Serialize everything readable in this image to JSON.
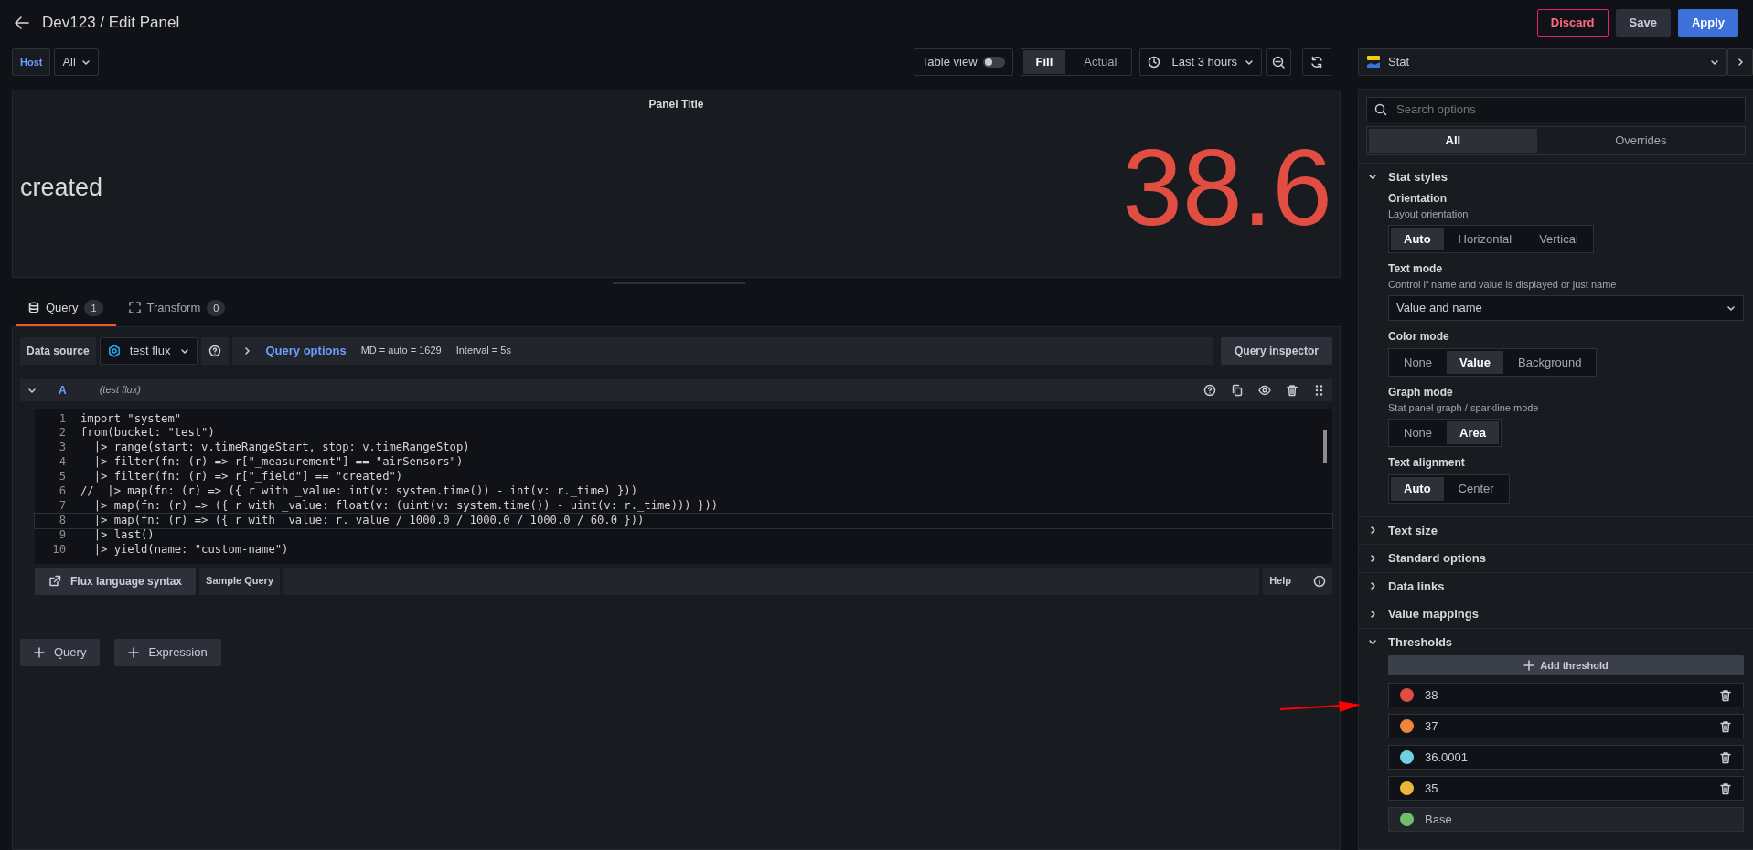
{
  "header": {
    "title": "Dev123 / Edit Panel",
    "buttons": [
      {
        "label": "Discard",
        "kind": "danger"
      },
      {
        "label": "Save",
        "kind": "secondary"
      },
      {
        "label": "Apply",
        "kind": "primary"
      }
    ]
  },
  "variables": [
    {
      "label": "Host",
      "value": "All"
    }
  ],
  "toolbar": {
    "table_view": {
      "label": "Table view",
      "on": false
    },
    "size_modes": [
      {
        "label": "Fill",
        "selected": true
      },
      {
        "label": "Actual",
        "selected": false
      }
    ],
    "time_range": "Last 3 hours"
  },
  "panel": {
    "title": "Panel Title",
    "name": "created",
    "value": "38.6"
  },
  "query_tabs": [
    {
      "label": "Query",
      "count": "1",
      "selected": true
    },
    {
      "label": "Transform",
      "count": "0",
      "selected": false
    }
  ],
  "query_bar": {
    "data_source_label": "Data source",
    "data_source": "test flux",
    "options_label": "Query options",
    "md": "MD = auto = 1629",
    "interval": "Interval = 5s",
    "inspector": "Query inspector"
  },
  "query": {
    "ref": "A",
    "source": "(test flux)",
    "expanded": true,
    "lines": [
      {
        "number": "1",
        "text": "import \"system\"",
        "current": false
      },
      {
        "number": "2",
        "text": "from(bucket: \"test\")",
        "current": false
      },
      {
        "number": "3",
        "text": "  |> range(start: v.timeRangeStart, stop: v.timeRangeStop)",
        "current": false
      },
      {
        "number": "4",
        "text": "  |> filter(fn: (r) => r[\"_measurement\"] == \"airSensors\")",
        "current": false
      },
      {
        "number": "5",
        "text": "  |> filter(fn: (r) => r[\"_field\"] == \"created\")",
        "current": false
      },
      {
        "number": "6",
        "text": "//  |> map(fn: (r) => ({ r with _value: int(v: system.time()) - int(v: r._time) }))",
        "current": false
      },
      {
        "number": "7",
        "text": "  |> map(fn: (r) => ({ r with _value: float(v: (uint(v: system.time()) - uint(v: r._time))) }))",
        "current": false
      },
      {
        "number": "8",
        "text": "  |> map(fn: (r) => ({ r with _value: r._value / 1000.0 / 1000.0 / 1000.0 / 60.0 }))",
        "current": true
      },
      {
        "number": "9",
        "text": "  |> last()",
        "current": false
      },
      {
        "number": "10",
        "text": "  |> yield(name: \"custom-name\")",
        "current": false
      }
    ]
  },
  "editor_footer": {
    "syntax": "Flux language syntax",
    "sample": "Sample Query",
    "help": "Help"
  },
  "add_buttons": [
    "Query",
    "Expression"
  ],
  "visualization": "Stat",
  "options": {
    "search_placeholder": "Search options",
    "tabs": [
      {
        "label": "All",
        "selected": true
      },
      {
        "label": "Overrides",
        "selected": false
      }
    ],
    "sections": [
      {
        "title": "Stat styles",
        "expanded": true,
        "fields": [
          {
            "kind": "radio",
            "label": "Orientation",
            "description": "Layout orientation",
            "options": [
              {
                "label": "Auto",
                "selected": true
              },
              {
                "label": "Horizontal",
                "selected": false
              },
              {
                "label": "Vertical",
                "selected": false
              }
            ]
          },
          {
            "kind": "select",
            "label": "Text mode",
            "description": "Control if name and value is displayed or just name",
            "value": "Value and name"
          },
          {
            "kind": "radio",
            "label": "Color mode",
            "options": [
              {
                "label": "None",
                "selected": false
              },
              {
                "label": "Value",
                "selected": true
              },
              {
                "label": "Background",
                "selected": false
              }
            ]
          },
          {
            "kind": "radio",
            "label": "Graph mode",
            "description": "Stat panel graph / sparkline mode",
            "options": [
              {
                "label": "None",
                "selected": false
              },
              {
                "label": "Area",
                "selected": true
              }
            ]
          },
          {
            "kind": "radio",
            "label": "Text alignment",
            "options": [
              {
                "label": "Auto",
                "selected": true
              },
              {
                "label": "Center",
                "selected": false
              }
            ]
          }
        ]
      },
      {
        "title": "Text size",
        "expanded": false
      },
      {
        "title": "Standard options",
        "expanded": false
      },
      {
        "title": "Data links",
        "expanded": false
      },
      {
        "title": "Value mappings",
        "expanded": false
      },
      {
        "title": "Thresholds",
        "expanded": true,
        "add_label": "Add threshold",
        "thresholds": [
          {
            "kind": "step",
            "value": "38",
            "color": "#e24d42"
          },
          {
            "kind": "step",
            "value": "37",
            "color": "#ef843c"
          },
          {
            "kind": "step",
            "value": "36.0001",
            "color": "#6ed0e0"
          },
          {
            "kind": "step",
            "value": "35",
            "color": "#eab839"
          },
          {
            "kind": "base",
            "value": "Base",
            "color": "#73bf69"
          }
        ]
      }
    ]
  }
}
